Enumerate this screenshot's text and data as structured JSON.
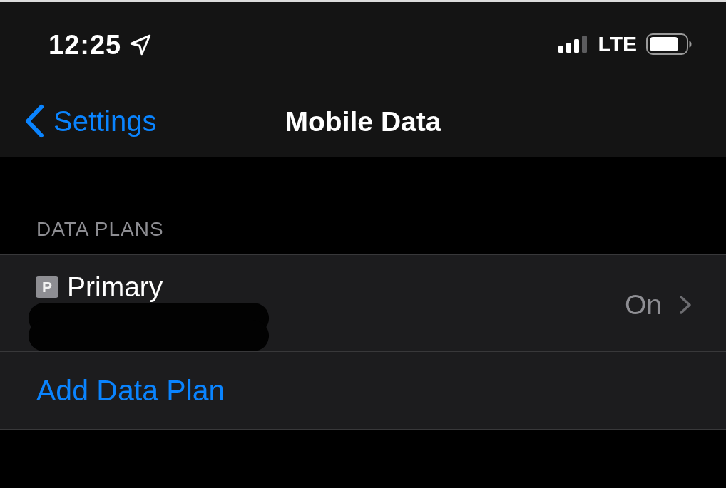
{
  "status_bar": {
    "time": "12:25",
    "network": "LTE"
  },
  "nav_bar": {
    "back_label": "Settings",
    "title": "Mobile Data"
  },
  "sections": [
    {
      "header": "DATA PLANS",
      "rows": [
        {
          "kind": "plan",
          "badge": "P",
          "label": "Primary",
          "value": "On",
          "redacted": true
        },
        {
          "kind": "action",
          "label": "Add Data Plan"
        }
      ]
    }
  ]
}
